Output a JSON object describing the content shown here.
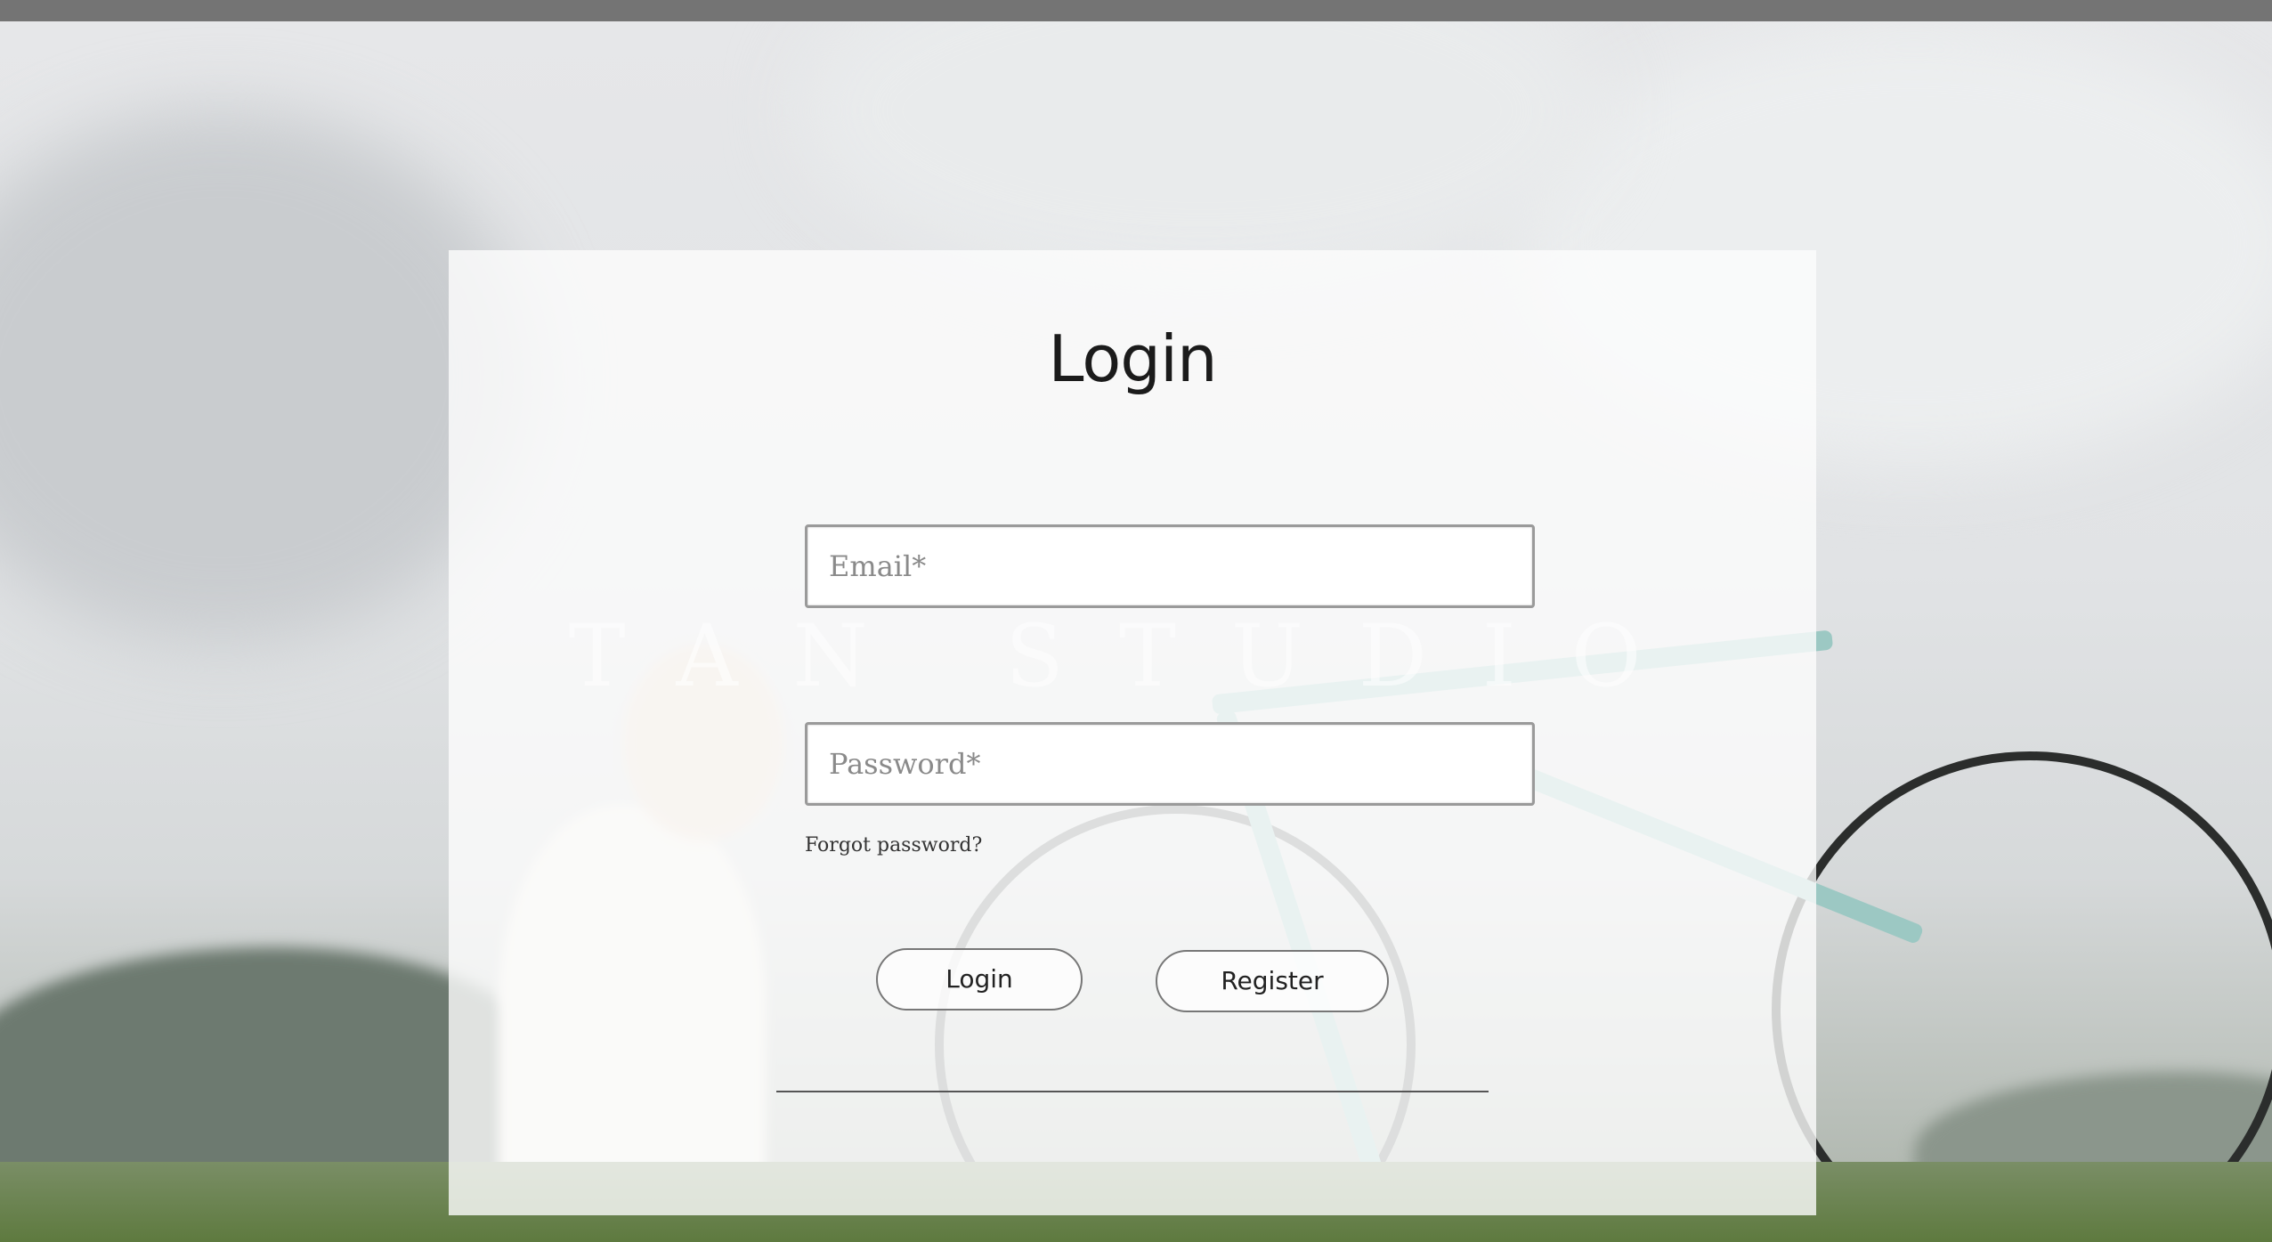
{
  "page": {
    "title": "Login",
    "watermark": "TAN STUDIO"
  },
  "form": {
    "email_placeholder": "Email*",
    "password_placeholder": "Password*",
    "forgot_label": "Forgot password?",
    "login_button": "Login",
    "register_button": "Register"
  },
  "colors": {
    "top_bar": "#747474",
    "panel_overlay": "#fcfcfc",
    "text": "#1b1b1b"
  }
}
